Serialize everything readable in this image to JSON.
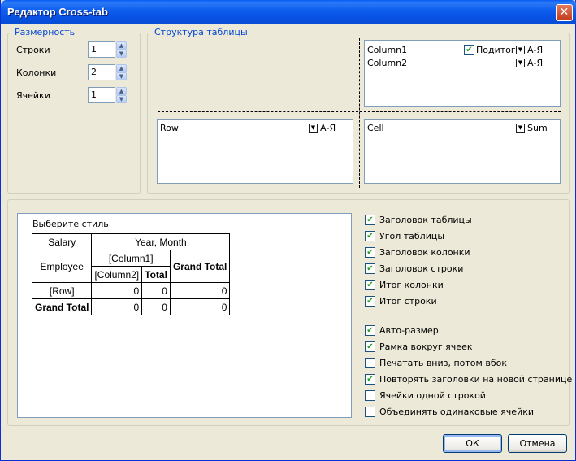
{
  "window": {
    "title": "Редактор Cross-tab",
    "close_label": "✕"
  },
  "dimension": {
    "legend": "Размерность",
    "rows_label": "Строки",
    "rows_value": "1",
    "columns_label": "Колонки",
    "columns_value": "2",
    "cells_label": "Ячейки",
    "cells_value": "1"
  },
  "structure": {
    "legend": "Структура таблицы",
    "columns_box": [
      {
        "name": "Column1",
        "subtotals_label": "Подитоги",
        "subtotals_checked": true,
        "sort": "А-Я"
      },
      {
        "name": "Column2",
        "sort": "А-Я"
      }
    ],
    "rows_box": [
      {
        "name": "Row",
        "sort": "А-Я"
      }
    ],
    "cells_box": [
      {
        "name": "Cell",
        "func": "Sum"
      }
    ]
  },
  "preview": {
    "label": "Выберите стиль",
    "cells": {
      "salary": "Salary",
      "year_month": "Year, Month",
      "employee": "Employee",
      "column1": "[Column1]",
      "column2": "[Column2]",
      "total": "Total",
      "grand_total": "Grand Total",
      "row": "[Row]",
      "zero": "0"
    }
  },
  "options": [
    {
      "label": "Заголовок таблицы",
      "checked": true
    },
    {
      "label": "Угол таблицы",
      "checked": true
    },
    {
      "label": "Заголовок колонки",
      "checked": true
    },
    {
      "label": "Заголовок строки",
      "checked": true
    },
    {
      "label": "Итог колонки",
      "checked": true
    },
    {
      "label": "Итог строки",
      "checked": true
    },
    {
      "label": "Авто-размер",
      "checked": true
    },
    {
      "label": "Рамка вокруг ячеек",
      "checked": true
    },
    {
      "label": "Печатать вниз, потом вбок",
      "checked": false
    },
    {
      "label": "Повторять заголовки на новой странице",
      "checked": true
    },
    {
      "label": "Ячейки одной строкой",
      "checked": false
    },
    {
      "label": "Объединять одинаковые ячейки",
      "checked": false
    }
  ],
  "buttons": {
    "ok": "ОК",
    "cancel": "Отмена"
  }
}
